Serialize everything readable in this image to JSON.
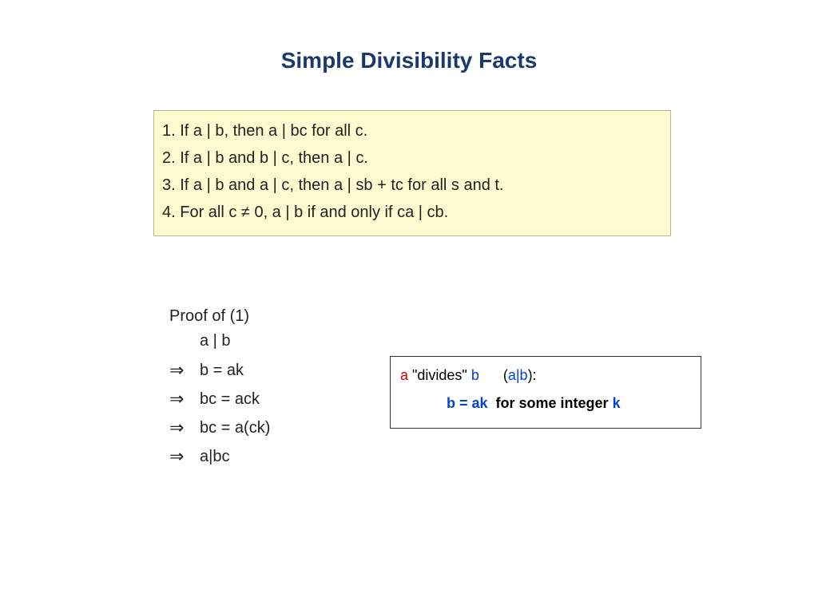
{
  "title": "Simple Divisibility Facts",
  "facts": {
    "f1": "1. If a | b, then a | bc for all c.",
    "f2": "2. If a | b and b | c, then a | c.",
    "f3": "3. If a | b and a | c, then a | sb + tc for all s and t.",
    "f4": "4. For all c ≠ 0, a | b if and only if ca | cb."
  },
  "proof": {
    "header": "Proof of (1)",
    "s0": "a | b",
    "s1": "b = ak",
    "s2": "bc = ack",
    "s3": "bc = a(ck)",
    "s4": "a|bc",
    "arrow": "⇒"
  },
  "defbox": {
    "a": "a",
    "divides": " \"divides\" ",
    "b": "b",
    "gap": "      ",
    "lparen": "(",
    "ab": "a|b",
    "rparen": "):",
    "eq_part": "b = ak",
    "mid_text": "  for some integer ",
    "k": "k"
  }
}
